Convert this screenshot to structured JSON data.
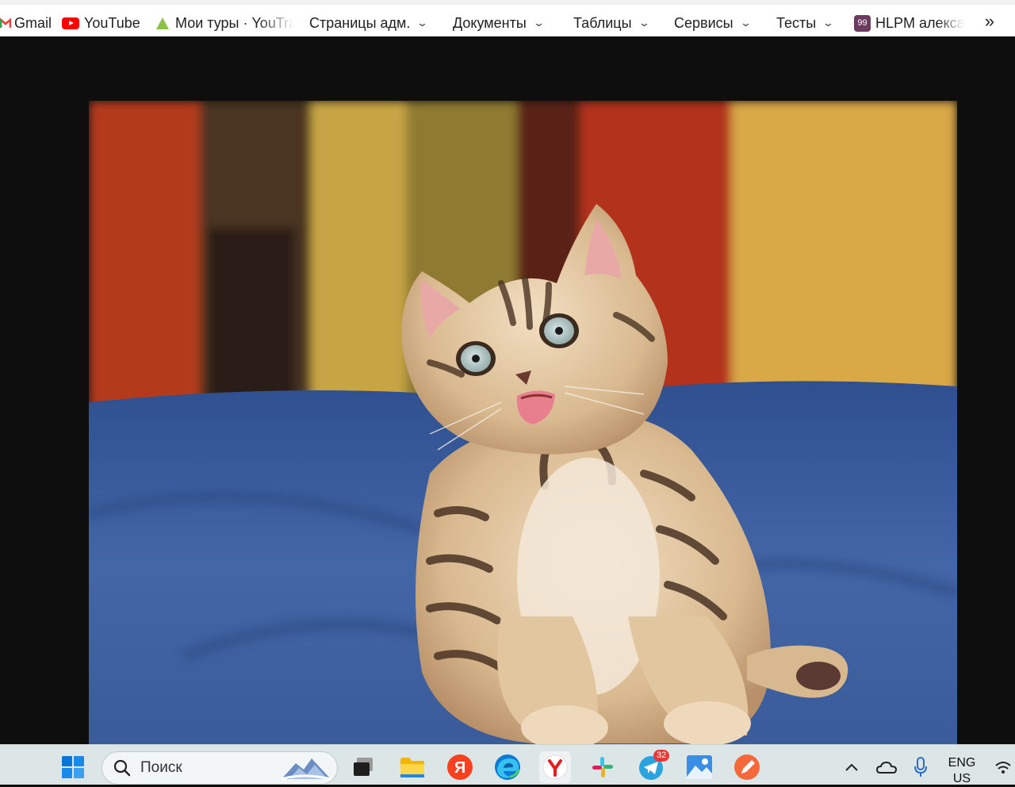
{
  "bookmarks": {
    "items": [
      {
        "label": "Gmail",
        "icon": "gmail-icon"
      },
      {
        "label": "YouTube",
        "icon": "youtube-icon"
      },
      {
        "label": "Мои туры · YouTra",
        "icon": "triangle-icon"
      },
      {
        "label": "Страницы адм.",
        "icon": "chevron-down-icon"
      },
      {
        "label": "Документы",
        "icon": "chevron-down-icon"
      },
      {
        "label": "Таблицы",
        "icon": "chevron-down-icon"
      },
      {
        "label": "Сервисы",
        "icon": "chevron-down-icon"
      },
      {
        "label": "Тесты",
        "icon": "chevron-down-icon"
      },
      {
        "label": "HLPM алекса",
        "icon": "99-badge-icon"
      }
    ],
    "badge_99": "99",
    "more": "»"
  },
  "viewer": {
    "image_icon": "photo-kitten",
    "colors": {
      "background": "#0e0e0e",
      "blanket": "#3f63a2",
      "wall_red": "#b53a1f",
      "wall_yellow": "#d9a848"
    }
  },
  "taskbar": {
    "search_placeholder": "Поиск",
    "telegram_badge": "32",
    "apps": [
      "windows-start-icon",
      "search-icon",
      "task-view-icon",
      "file-explorer-icon",
      "yandex-icon",
      "edge-icon",
      "yandex-browser-icon",
      "slack-icon",
      "telegram-icon",
      "photos-icon",
      "pen-app-icon"
    ],
    "tray": {
      "lang_line1": "ENG",
      "lang_line2": "US",
      "icons": [
        "chevron-up-icon",
        "onedrive-icon",
        "microphone-icon",
        "wifi-icon"
      ]
    }
  }
}
